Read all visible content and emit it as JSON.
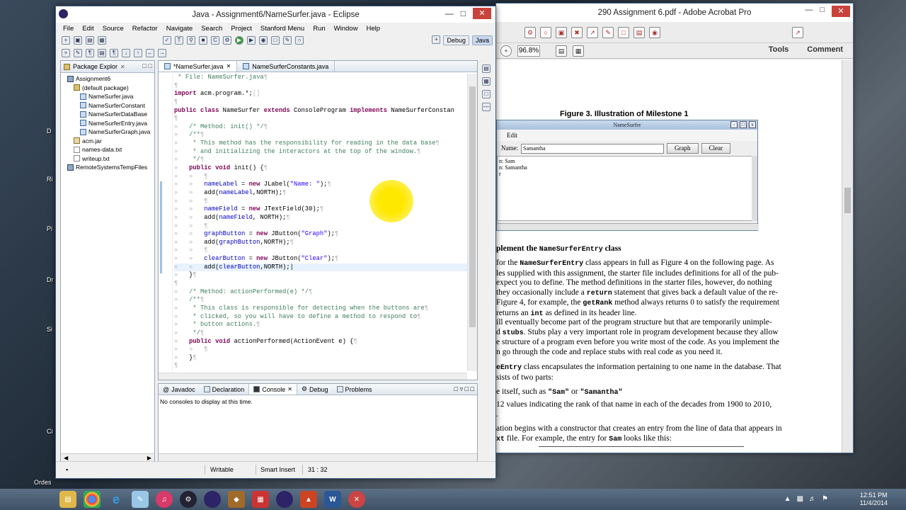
{
  "desktop": {
    "labels": [
      "D",
      "Ri",
      "Pi",
      "Dr",
      "Si",
      "Ci",
      "Ordes"
    ]
  },
  "acrobat": {
    "title": "290 Assignment 6.pdf - Adobe Acrobat Pro",
    "zoom": "96.8%",
    "tools_label": "Tools",
    "comment_label": "Comment",
    "figure_caption": "Figure 3.  Illustration of Milestone 1",
    "namesurfer_window": {
      "title": "NameSurfer",
      "menu": "Edit",
      "name_label": "Name:",
      "name_value": "Samantha",
      "graph_label": "Graph",
      "clear_label": "Clear",
      "output_lines": [
        "n: Sam",
        "n: Samantha",
        "r"
      ]
    },
    "text": {
      "heading_pre": "plement the ",
      "heading_mono": "NameSurferEntry",
      "heading_post": " class",
      "p1": [
        {
          "pre": "for the ",
          "mono": "NameSurferEntry",
          "post": " class appears in full as Figure 4 on the following page. As"
        },
        {
          "pre": "les supplied with this assignment, the starter file includes definitions for all of the pub-"
        },
        {
          "pre": "expect you to define. The method definitions in the starter files, however, do nothing"
        },
        {
          "pre": "they occasionally include a ",
          "mono": "return",
          "post": " statement that gives back a default value of the re-"
        },
        {
          "pre": "Figure 4, for example, the ",
          "mono": "getRank",
          "post": " method always returns 0 to satisfy the requirement"
        },
        {
          "pre": "returns an ",
          "mono": "int",
          "post": " as defined in its header line."
        }
      ],
      "p2": [
        {
          "pre": "ill eventually become part of the program structure but that are temporarily unimple-"
        },
        {
          "pre": "d ",
          "mono": "stubs",
          "post": ". Stubs play a very important role in program development because they allow"
        },
        {
          "pre": "e structure of a program even before you write most of the code. As you implement the"
        },
        {
          "pre": "n go through the code and replace stubs with real code as you need it."
        }
      ],
      "p3": [
        {
          "pre": "",
          "mono": "eEntry",
          "post": " class encapsulates the information pertaining to one name in the database.  That"
        },
        {
          "pre": "sists of two parts:"
        }
      ],
      "b1": {
        "pre": "e itself, such as ",
        "mono": "\"Sam\"",
        "mid": " or ",
        "mono2": "\"Samantha\""
      },
      "b2": [
        "12 values indicating the rank of that name in each of the decades from 1900 to 2010,",
        "."
      ],
      "p4": [
        {
          "pre": "ation begins with a constructor that creates an entry from the line of data that appears in"
        },
        {
          "pre": "",
          "mono": "xt",
          "post": " file.  For example, the entry for ",
          "mono2": "Sam",
          "post2": " looks like this:"
        }
      ]
    }
  },
  "eclipse": {
    "title": "Java - Assignment6/NameSurfer.java - Eclipse",
    "menus": [
      "File",
      "Edit",
      "Source",
      "Refactor",
      "Navigate",
      "Search",
      "Project",
      "Stanford Menu",
      "Run",
      "Window",
      "Help"
    ],
    "perspectives": [
      "Debug",
      "Java"
    ],
    "package_explorer": {
      "tab": "Package Explor",
      "tree": [
        {
          "label": "Assignment6",
          "indent": 1,
          "icon": "proj"
        },
        {
          "label": "(default package)",
          "indent": 2,
          "icon": "pkgi"
        },
        {
          "label": "NameSurfer.java",
          "indent": 3,
          "icon": "java"
        },
        {
          "label": "NameSurferConstant",
          "indent": 3,
          "icon": "java"
        },
        {
          "label": "NameSurferDataBase",
          "indent": 3,
          "icon": "java"
        },
        {
          "label": "NameSurferEntry.java",
          "indent": 3,
          "icon": "java"
        },
        {
          "label": "NameSurferGraph.java",
          "indent": 3,
          "icon": "java"
        },
        {
          "label": "acm.jar",
          "indent": 2,
          "icon": "jar"
        },
        {
          "label": "names-data.txt",
          "indent": 2,
          "icon": "txt"
        },
        {
          "label": "writeup.txt",
          "indent": 2,
          "icon": "txt"
        },
        {
          "label": "RemoteSystemsTempFiles",
          "indent": 1,
          "icon": "proj"
        }
      ]
    },
    "editor_tabs": [
      "*NameSurfer.java",
      "NameSurferConstants.java"
    ],
    "code_lines": [
      "<span class='cm'> * File: NameSurfer.java</span><span class='ws'>¶</span>",
      "<span class='ws'>¶</span>",
      "<span class='kw'>import</span> acm.program.*;<span class='ws'>[]</span>",
      "<span class='ws'>¶</span>",
      "<span class='kw'>public class</span> NameSurfer <span class='kw'>extends</span> ConsoleProgram <span class='kw'>implements</span> NameSurferConstan",
      "<span class='ws'>¶</span>",
      "<span class='ws'>»   </span><span class='cm'>/* Method: init() */</span><span class='ws'>¶</span>",
      "<span class='ws'>»   </span><span class='cm'>/**</span><span class='ws'>¶</span>",
      "<span class='ws'>»   </span><span class='cm'> * This method has the responsibility for reading in the data base</span><span class='ws'>¶</span>",
      "<span class='ws'>»   </span><span class='cm'> * and initializing the interactors at the top of the window.</span><span class='ws'>¶</span>",
      "<span class='ws'>»   </span><span class='cm'> */</span><span class='ws'>¶</span>",
      "<span class='ws'>»   </span><span class='kw'>public void</span> init() {<span class='ws'>¶</span>",
      "<span class='ws'>»   »   ¶</span>",
      "<span class='ws'>»   »   </span><span class='fd'>nameLabel</span> = <span class='kw'>new</span> JLabel(<span class='st'>\"Name: \"</span>);<span class='ws'>¶</span>",
      "<span class='ws'>»   »   </span>add(<span class='fd'>nameLabel</span>,NORTH);<span class='ws'>¶</span>",
      "<span class='ws'>»   »   ¶</span>",
      "<span class='ws'>»   »   </span><span class='fd'>nameField</span> = <span class='kw'>new</span> JTextField(30);<span class='ws'>¶</span>",
      "<span class='ws'>»   »   </span>add(<span class='fd'>nameField</span>, NORTH);<span class='ws'>¶</span>",
      "<span class='ws'>»   »   ¶</span>",
      "<span class='ws'>»   »   </span><span class='fd'>graphButton</span> = <span class='kw'>new</span> JButton(<span class='st'>\"Graph\"</span>);<span class='ws'>¶</span>",
      "<span class='ws'>»   »   </span>add(<span class='fd'>graphButton</span>,NORTH);<span class='ws'>¶</span>",
      "<span class='ws'>»   »   ¶</span>",
      "<span class='ws'>»   »   </span><span class='fd'>clearButton</span> = <span class='kw'>new</span> JButton(<span class='st'>\"Clear\"</span>);<span class='ws'>¶</span>",
      "<span class='ws'>»   »   </span>add(<span class='fd'>clearButton</span>,NORTH);|",
      "<span class='ws'>»   </span>}<span class='ws'>¶</span>",
      "<span class='ws'>¶</span>",
      "<span class='ws'>»   </span><span class='cm'>/* Method: actionPerformed(e) */</span><span class='ws'>¶</span>",
      "<span class='ws'>»   </span><span class='cm'>/**</span><span class='ws'>¶</span>",
      "<span class='ws'>»   </span><span class='cm'> * This class is responsible for detecting when the buttons are</span><span class='ws'>¶</span>",
      "<span class='ws'>»   </span><span class='cm'> * clicked, so you will have to define a method to respond to</span><span class='ws'>¶</span>",
      "<span class='ws'>»   </span><span class='cm'> * button actions.</span><span class='ws'>¶</span>",
      "<span class='ws'>»   </span><span class='cm'> */</span><span class='ws'>¶</span>",
      "<span class='ws'>»   </span><span class='kw'>public void</span> actionPerformed(ActionEvent e) {<span class='ws'>¶</span>",
      "<span class='ws'>»   »   ¶</span>",
      "<span class='ws'>»   </span>}<span class='ws'>¶</span>",
      "<span class='ws'>¶</span>"
    ],
    "console_tabs": [
      "Javadoc",
      "Declaration",
      "Console",
      "Debug",
      "Problems"
    ],
    "console_message": "No consoles to display at this time.",
    "status": {
      "writable": "Writable",
      "insert": "Smart Insert",
      "position": "31 : 32"
    }
  },
  "taskbar": {
    "apps": [
      "file-explorer",
      "chrome",
      "ie",
      "notepad",
      "itunes",
      "steam",
      "eclipse",
      "game",
      "calendar",
      "eclipse2",
      "acrobat",
      "word",
      "snipping"
    ],
    "time": "12:51 PM",
    "date": "11/4/2014"
  }
}
